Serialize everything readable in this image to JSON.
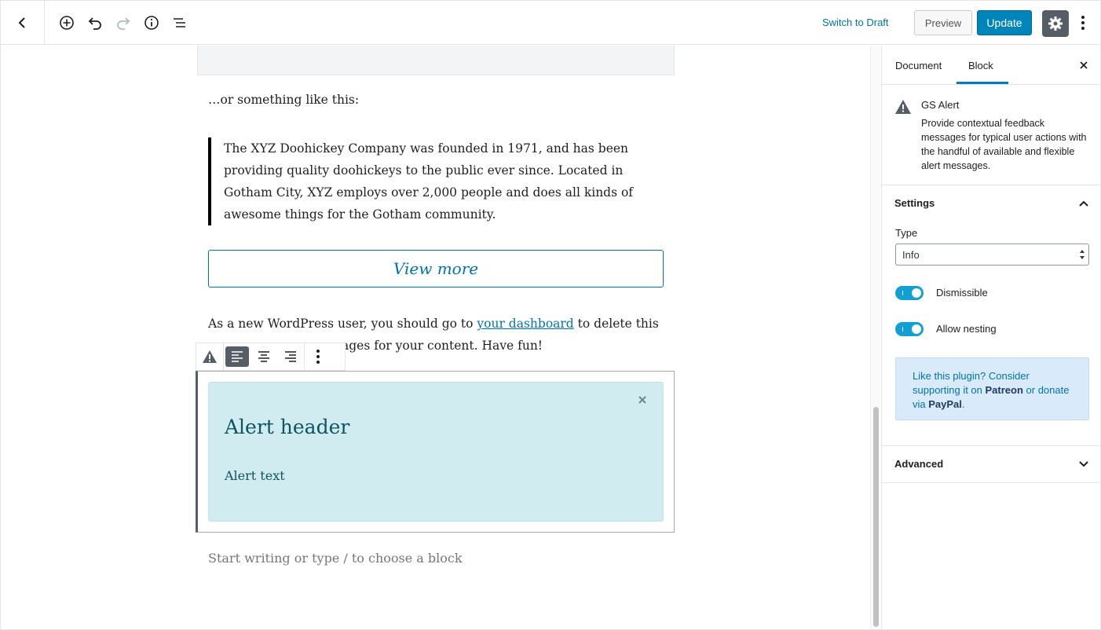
{
  "toolbar": {
    "switch_to_draft": "Switch to Draft",
    "preview": "Preview",
    "update": "Update"
  },
  "editor": {
    "intro": "…or something like this:",
    "quote": "The XYZ Doohickey Company was founded in 1971, and has been providing quality doohickeys to the public ever since. Located in Gotham City, XYZ employs over 2,000 people and does all kinds of awesome things for the Gotham community.",
    "view_more": "View more",
    "para_before": "As a new WordPress user, you should go to ",
    "para_link": "your dashboard",
    "para_line1_after": " to delete this",
    "para_line2_visible": "ages for your content. Have fun!",
    "alert_header": "Alert header",
    "alert_text": "Alert text",
    "placeholder": "Start writing or type / to choose a block"
  },
  "sidebar": {
    "tabs": [
      "Document",
      "Block"
    ],
    "active_tab": "Block",
    "block_title": "GS Alert",
    "block_desc": "Provide contextual feedback messages for typical user actions with the handful of available and flexible alert messages.",
    "settings_title": "Settings",
    "type_label": "Type",
    "type_value": "Info",
    "dismissible_label": "Dismissible",
    "allow_nesting_label": "Allow nesting",
    "notice_part1": "Like this plugin? Consider supporting it on ",
    "notice_patreon": "Patreon",
    "notice_part2": " or donate via ",
    "notice_paypal": "PayPal",
    "notice_part3": ".",
    "advanced_title": "Advanced"
  },
  "colors": {
    "accent": "#0085ba",
    "link": "#0073aa",
    "alert_bg": "#d1ecf1",
    "alert_text": "#0c5460",
    "toggle_on": "#11a0d2"
  },
  "icons": [
    "back-arrow-icon",
    "add-block-icon",
    "undo-icon",
    "redo-icon",
    "info-icon",
    "outline-icon",
    "gear-icon",
    "kebab-icon",
    "warning-icon",
    "align-left-icon",
    "align-center-icon",
    "align-right-icon",
    "close-icon",
    "chevron-up-icon",
    "chevron-down-icon"
  ]
}
